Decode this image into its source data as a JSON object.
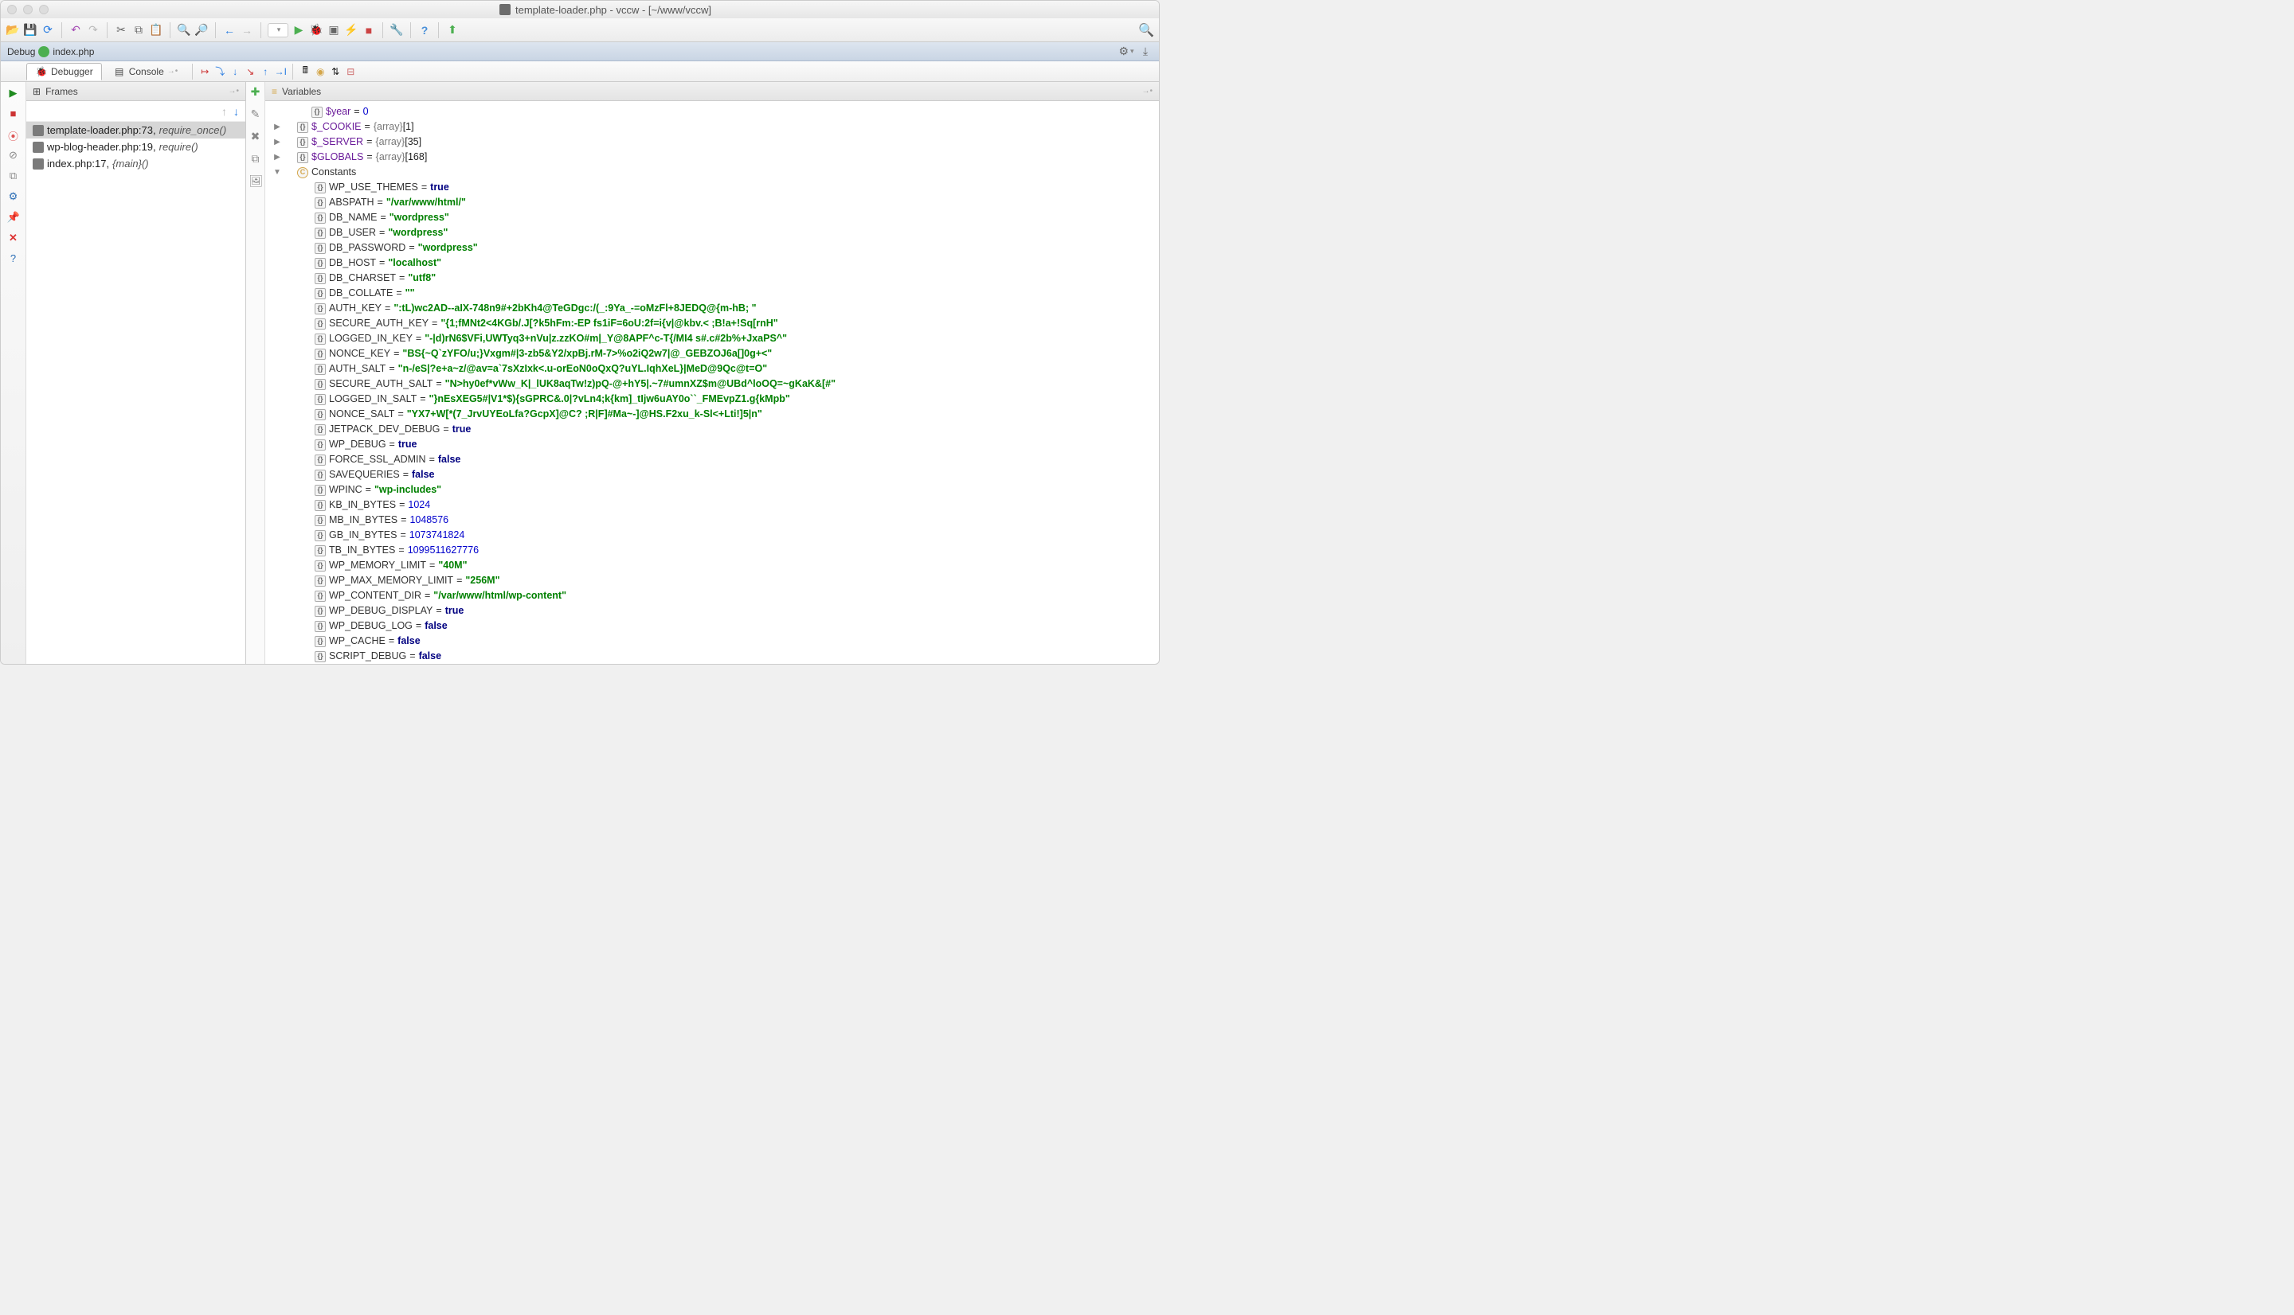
{
  "window": {
    "title": "template-loader.php - vccw - [~/www/vccw]"
  },
  "debugToolWindow": {
    "title": "Debug",
    "session": "index.php"
  },
  "tabs": {
    "debugger": "Debugger",
    "console": "Console"
  },
  "framesPanel": {
    "title": "Frames"
  },
  "variablesPanel": {
    "title": "Variables"
  },
  "frames": [
    {
      "file": "template-loader.php",
      "line": "73",
      "fn": "require_once()",
      "selected": true
    },
    {
      "file": "wp-blog-header.php",
      "line": "19",
      "fn": "require()",
      "selected": false
    },
    {
      "file": "index.php",
      "line": "17",
      "fn": "{main}()",
      "selected": false
    }
  ],
  "topVars": [
    {
      "toggle": "",
      "indent": 2,
      "name": "$year",
      "vtype": "num",
      "value": "0"
    },
    {
      "toggle": "▶",
      "indent": 1,
      "name": "$_COOKIE",
      "vtype": "arr",
      "value": "{array} [1]"
    },
    {
      "toggle": "▶",
      "indent": 1,
      "name": "$_SERVER",
      "vtype": "arr",
      "value": "{array} [35]"
    },
    {
      "toggle": "▶",
      "indent": 1,
      "name": "$GLOBALS",
      "vtype": "arr",
      "value": "{array} [168]"
    }
  ],
  "constantsLabel": "Constants",
  "constants": [
    {
      "name": "WP_USE_THEMES",
      "vtype": "bool",
      "value": "true"
    },
    {
      "name": "ABSPATH",
      "vtype": "str",
      "value": "\"/var/www/html/\""
    },
    {
      "name": "DB_NAME",
      "vtype": "str",
      "value": "\"wordpress\""
    },
    {
      "name": "DB_USER",
      "vtype": "str",
      "value": "\"wordpress\""
    },
    {
      "name": "DB_PASSWORD",
      "vtype": "str",
      "value": "\"wordpress\""
    },
    {
      "name": "DB_HOST",
      "vtype": "str",
      "value": "\"localhost\""
    },
    {
      "name": "DB_CHARSET",
      "vtype": "str",
      "value": "\"utf8\""
    },
    {
      "name": "DB_COLLATE",
      "vtype": "str",
      "value": "\"\""
    },
    {
      "name": "AUTH_KEY",
      "vtype": "str",
      "value": "\":tL)wc2AD--aIX-748n9#+2bKh4@TeGDgc:/(_:9Ya_-=oMzFl+8JEDQ@{m-hB; \""
    },
    {
      "name": "SECURE_AUTH_KEY",
      "vtype": "str",
      "value": "\"{1;fMNt2<4KGb/.J[?k5hFm:-EP fs1iF=6oU:2f=i{v|@kbv.< ;B!a+!Sq[rnH\""
    },
    {
      "name": "LOGGED_IN_KEY",
      "vtype": "str",
      "value": "\"-|d)rN6$VFi,UWTyq3+nVu|z.zzKO#m|_Y@8APF^c-T{/MI4 s#.c#2b%+JxaPS^\""
    },
    {
      "name": "NONCE_KEY",
      "vtype": "str",
      "value": "\"BS{~Q`zYFO/u;}Vxgm#|3-zb5&Y2/xpBj.rM-7>%o2iQ2w7|@_GEBZOJ6a[]0g+<\""
    },
    {
      "name": "AUTH_SALT",
      "vtype": "str",
      "value": "\"n-/eS|?e+a~z/@av=a`7sXzIxk<.u-orEoN0oQxQ?uYL.IqhXeL}|MeD@9Qc@t=O\""
    },
    {
      "name": "SECURE_AUTH_SALT",
      "vtype": "str",
      "value": "\"N>hy0ef*vWw_K|_lUK8aqTw!z)pQ-@+hY5|.~7#umnXZ$m@UBd^loOQ=~gKaK&[#\""
    },
    {
      "name": "LOGGED_IN_SALT",
      "vtype": "str",
      "value": "\"}nEsXEG5#|V1*$){sGPRC&.0|?vLn4;k{km]_tIjw6uAY0o``_FMEvpZ1.g{kMpb\""
    },
    {
      "name": "NONCE_SALT",
      "vtype": "str",
      "value": "\"YX7+W[*(7_JrvUYEoLfa?GcpX]@C? ;R|F]#Ma~-]@HS.F2xu_k-Sl<+Lti!]5|n\""
    },
    {
      "name": "JETPACK_DEV_DEBUG",
      "vtype": "bool",
      "value": "true"
    },
    {
      "name": "WP_DEBUG",
      "vtype": "bool",
      "value": "true"
    },
    {
      "name": "FORCE_SSL_ADMIN",
      "vtype": "bool",
      "value": "false"
    },
    {
      "name": "SAVEQUERIES",
      "vtype": "bool",
      "value": "false"
    },
    {
      "name": "WPINC",
      "vtype": "str",
      "value": "\"wp-includes\""
    },
    {
      "name": "KB_IN_BYTES",
      "vtype": "num",
      "value": "1024"
    },
    {
      "name": "MB_IN_BYTES",
      "vtype": "num",
      "value": "1048576"
    },
    {
      "name": "GB_IN_BYTES",
      "vtype": "num",
      "value": "1073741824"
    },
    {
      "name": "TB_IN_BYTES",
      "vtype": "num",
      "value": "1099511627776"
    },
    {
      "name": "WP_MEMORY_LIMIT",
      "vtype": "str",
      "value": "\"40M\""
    },
    {
      "name": "WP_MAX_MEMORY_LIMIT",
      "vtype": "str",
      "value": "\"256M\""
    },
    {
      "name": "WP_CONTENT_DIR",
      "vtype": "str",
      "value": "\"/var/www/html/wp-content\""
    },
    {
      "name": "WP_DEBUG_DISPLAY",
      "vtype": "bool",
      "value": "true"
    },
    {
      "name": "WP_DEBUG_LOG",
      "vtype": "bool",
      "value": "false"
    },
    {
      "name": "WP_CACHE",
      "vtype": "bool",
      "value": "false"
    },
    {
      "name": "SCRIPT_DEBUG",
      "vtype": "bool",
      "value": "false"
    }
  ]
}
